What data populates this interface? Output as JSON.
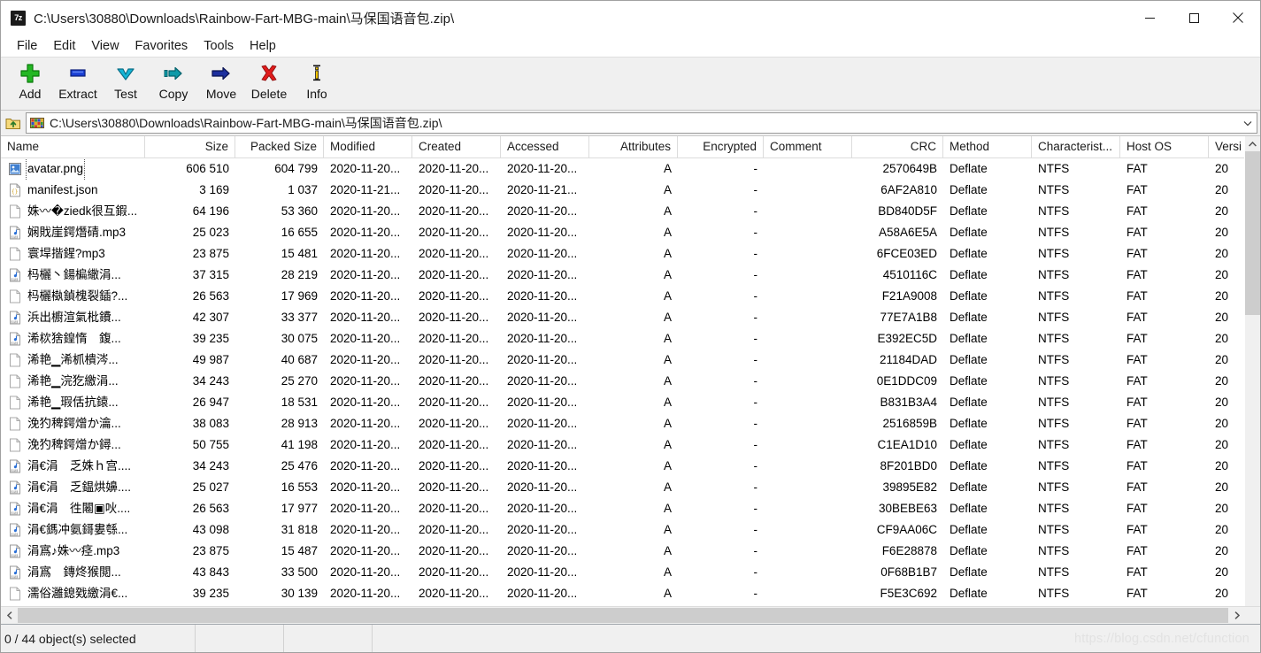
{
  "window": {
    "app_icon": "sevenzip-icon",
    "title": "C:\\Users\\30880\\Downloads\\Rainbow-Fart-MBG-main\\马保国语音包.zip\\",
    "minimize_label": "Minimize",
    "maximize_label": "Maximize",
    "close_label": "Close"
  },
  "menubar": {
    "items": [
      {
        "label": "File"
      },
      {
        "label": "Edit"
      },
      {
        "label": "View"
      },
      {
        "label": "Favorites"
      },
      {
        "label": "Tools"
      },
      {
        "label": "Help"
      }
    ]
  },
  "toolbar": {
    "buttons": [
      {
        "label": "Add",
        "icon": "plus-icon"
      },
      {
        "label": "Extract",
        "icon": "extract-icon"
      },
      {
        "label": "Test",
        "icon": "checkmark-down-icon"
      },
      {
        "label": "Copy",
        "icon": "copy-arrow-icon"
      },
      {
        "label": "Move",
        "icon": "move-arrow-icon"
      },
      {
        "label": "Delete",
        "icon": "red-x-icon"
      },
      {
        "label": "Info",
        "icon": "info-icon"
      }
    ]
  },
  "address": {
    "up_icon": "folder-up-icon",
    "archive_icon": "archive-icon",
    "path": "C:\\Users\\30880\\Downloads\\Rainbow-Fart-MBG-main\\马保国语音包.zip\\",
    "dropdown_icon": "chevron-down-icon"
  },
  "columns": [
    {
      "key": "name",
      "label": "Name",
      "width": 163,
      "align": "l"
    },
    {
      "key": "size",
      "label": "Size",
      "width": 102,
      "align": "r"
    },
    {
      "key": "packed",
      "label": "Packed Size",
      "width": 100,
      "align": "r"
    },
    {
      "key": "modified",
      "label": "Modified",
      "width": 100,
      "align": "l"
    },
    {
      "key": "created",
      "label": "Created",
      "width": 100,
      "align": "l"
    },
    {
      "key": "accessed",
      "label": "Accessed",
      "width": 100,
      "align": "l"
    },
    {
      "key": "attributes",
      "label": "Attributes",
      "width": 100,
      "align": "r"
    },
    {
      "key": "encrypted",
      "label": "Encrypted",
      "width": 97,
      "align": "r"
    },
    {
      "key": "comment",
      "label": "Comment",
      "width": 100,
      "align": "l"
    },
    {
      "key": "crc",
      "label": "CRC",
      "width": 103,
      "align": "r"
    },
    {
      "key": "method",
      "label": "Method",
      "width": 100,
      "align": "l"
    },
    {
      "key": "charact",
      "label": "Characterist...",
      "width": 100,
      "align": "l"
    },
    {
      "key": "hostos",
      "label": "Host OS",
      "width": 100,
      "align": "l"
    },
    {
      "key": "version",
      "label": "Versi",
      "width": 42,
      "align": "l"
    }
  ],
  "rows": [
    {
      "icon": "image-file-icon",
      "name": "avatar.png",
      "size": "606 510",
      "packed": "604 799",
      "modified": "2020-11-20...",
      "created": "2020-11-20...",
      "accessed": "2020-11-20...",
      "attributes": "A",
      "encrypted": "-",
      "comment": "",
      "crc": "2570649B",
      "method": "Deflate",
      "charact": "NTFS",
      "hostos": "FAT",
      "version": "20",
      "focus": true
    },
    {
      "icon": "json-file-icon",
      "name": "manifest.json",
      "size": "3 169",
      "packed": "1 037",
      "modified": "2020-11-21...",
      "created": "2020-11-20...",
      "accessed": "2020-11-21...",
      "attributes": "A",
      "encrypted": "-",
      "comment": "",
      "crc": "6AF2A810",
      "method": "Deflate",
      "charact": "NTFS",
      "hostos": "FAT",
      "version": "20"
    },
    {
      "icon": "generic-file-icon",
      "name": "姝〰�ziedk很互鍜...",
      "size": "64 196",
      "packed": "53 360",
      "modified": "2020-11-20...",
      "created": "2020-11-20...",
      "accessed": "2020-11-20...",
      "attributes": "A",
      "encrypted": "-",
      "comment": "",
      "crc": "BD840D5F",
      "method": "Deflate",
      "charact": "NTFS",
      "hostos": "FAT",
      "version": "20"
    },
    {
      "icon": "mp3-file-icon",
      "name": "娴戝崖鍔熸碃.mp3",
      "size": "25 023",
      "packed": "16 655",
      "modified": "2020-11-20...",
      "created": "2020-11-20...",
      "accessed": "2020-11-20...",
      "attributes": "A",
      "encrypted": "-",
      "comment": "",
      "crc": "A58A6E5A",
      "method": "Deflate",
      "charact": "NTFS",
      "hostos": "FAT",
      "version": "20"
    },
    {
      "icon": "generic-file-icon",
      "name": "寰垾揩鍟?mp3",
      "size": "23 875",
      "packed": "15 481",
      "modified": "2020-11-20...",
      "created": "2020-11-20...",
      "accessed": "2020-11-20...",
      "attributes": "A",
      "encrypted": "-",
      "comment": "",
      "crc": "6FCE03ED",
      "method": "Deflate",
      "charact": "NTFS",
      "hostos": "FAT",
      "version": "20"
    },
    {
      "icon": "mp3-file-icon",
      "name": "杩欐丶鍚楄繖涓...",
      "size": "37 315",
      "packed": "28 219",
      "modified": "2020-11-20...",
      "created": "2020-11-20...",
      "accessed": "2020-11-20...",
      "attributes": "A",
      "encrypted": "-",
      "comment": "",
      "crc": "4510116C",
      "method": "Deflate",
      "charact": "NTFS",
      "hostos": "FAT",
      "version": "20"
    },
    {
      "icon": "generic-file-icon",
      "name": "杩欐槸鍞槐裂鍤?...",
      "size": "26 563",
      "packed": "17 969",
      "modified": "2020-11-20...",
      "created": "2020-11-20...",
      "accessed": "2020-11-20...",
      "attributes": "A",
      "encrypted": "-",
      "comment": "",
      "crc": "F21A9008",
      "method": "Deflate",
      "charact": "NTFS",
      "hostos": "FAT",
      "version": "20"
    },
    {
      "icon": "mp3-file-icon",
      "name": "浜出櫥渲氣枇鐨...",
      "size": "42 307",
      "packed": "33 377",
      "modified": "2020-11-20...",
      "created": "2020-11-20...",
      "accessed": "2020-11-20...",
      "attributes": "A",
      "encrypted": "-",
      "comment": "",
      "crc": "77E7A1B8",
      "method": "Deflate",
      "charact": "NTFS",
      "hostos": "FAT",
      "version": "20"
    },
    {
      "icon": "mp3-file-icon",
      "name": "浠栨猞鍠惰　鍑...",
      "size": "39 235",
      "packed": "30 075",
      "modified": "2020-11-20...",
      "created": "2020-11-20...",
      "accessed": "2020-11-20...",
      "attributes": "A",
      "encrypted": "-",
      "comment": "",
      "crc": "E392EC5D",
      "method": "Deflate",
      "charact": "NTFS",
      "hostos": "FAT",
      "version": "20"
    },
    {
      "icon": "generic-file-icon",
      "name": "浠艳▁浠枛樻涔...",
      "size": "49 987",
      "packed": "40 687",
      "modified": "2020-11-20...",
      "created": "2020-11-20...",
      "accessed": "2020-11-20...",
      "attributes": "A",
      "encrypted": "-",
      "comment": "",
      "crc": "21184DAD",
      "method": "Deflate",
      "charact": "NTFS",
      "hostos": "FAT",
      "version": "20"
    },
    {
      "icon": "generic-file-icon",
      "name": "浠艳▁浣犵繳涓...",
      "size": "34 243",
      "packed": "25 270",
      "modified": "2020-11-20...",
      "created": "2020-11-20...",
      "accessed": "2020-11-20...",
      "attributes": "A",
      "encrypted": "-",
      "comment": "",
      "crc": "0E1DDC09",
      "method": "Deflate",
      "charact": "NTFS",
      "hostos": "FAT",
      "version": "20"
    },
    {
      "icon": "generic-file-icon",
      "name": "浠艳▁瑕佸抗鎱...",
      "size": "26 947",
      "packed": "18 531",
      "modified": "2020-11-20...",
      "created": "2020-11-20...",
      "accessed": "2020-11-20...",
      "attributes": "A",
      "encrypted": "-",
      "comment": "",
      "crc": "B831B3A4",
      "method": "Deflate",
      "charact": "NTFS",
      "hostos": "FAT",
      "version": "20"
    },
    {
      "icon": "generic-file-icon",
      "name": "浼犳稗鍔熷か瀹...",
      "size": "38 083",
      "packed": "28 913",
      "modified": "2020-11-20...",
      "created": "2020-11-20...",
      "accessed": "2020-11-20...",
      "attributes": "A",
      "encrypted": "-",
      "comment": "",
      "crc": "2516859B",
      "method": "Deflate",
      "charact": "NTFS",
      "hostos": "FAT",
      "version": "20"
    },
    {
      "icon": "generic-file-icon",
      "name": "浼犳稗鍔熷か鐞...",
      "size": "50 755",
      "packed": "41 198",
      "modified": "2020-11-20...",
      "created": "2020-11-20...",
      "accessed": "2020-11-20...",
      "attributes": "A",
      "encrypted": "-",
      "comment": "",
      "crc": "C1EA1D10",
      "method": "Deflate",
      "charact": "NTFS",
      "hostos": "FAT",
      "version": "20"
    },
    {
      "icon": "mp3-file-icon",
      "name": "涓€涓　乏姝ｈ宫....",
      "size": "34 243",
      "packed": "25 476",
      "modified": "2020-11-20...",
      "created": "2020-11-20...",
      "accessed": "2020-11-20...",
      "attributes": "A",
      "encrypted": "-",
      "comment": "",
      "crc": "8F201BD0",
      "method": "Deflate",
      "charact": "NTFS",
      "hostos": "FAT",
      "version": "20"
    },
    {
      "icon": "mp3-file-icon",
      "name": "涓€涓　乏鎾烘嬶....",
      "size": "25 027",
      "packed": "16 553",
      "modified": "2020-11-20...",
      "created": "2020-11-20...",
      "accessed": "2020-11-20...",
      "attributes": "A",
      "encrypted": "-",
      "comment": "",
      "crc": "39895E82",
      "method": "Deflate",
      "charact": "NTFS",
      "hostos": "FAT",
      "version": "20"
    },
    {
      "icon": "mp3-file-icon",
      "name": "涓€涓　徃闂▣吙....",
      "size": "26 563",
      "packed": "17 977",
      "modified": "2020-11-20...",
      "created": "2020-11-20...",
      "accessed": "2020-11-20...",
      "attributes": "A",
      "encrypted": "-",
      "comment": "",
      "crc": "30BEBE63",
      "method": "Deflate",
      "charact": "NTFS",
      "hostos": "FAT",
      "version": "20"
    },
    {
      "icon": "mp3-file-icon",
      "name": "涓€鎷冲氨鎶婁綔...",
      "size": "43 098",
      "packed": "31 818",
      "modified": "2020-11-20...",
      "created": "2020-11-20...",
      "accessed": "2020-11-20...",
      "attributes": "A",
      "encrypted": "-",
      "comment": "",
      "crc": "CF9AA06C",
      "method": "Deflate",
      "charact": "NTFS",
      "hostos": "FAT",
      "version": "20"
    },
    {
      "icon": "mp3-file-icon",
      "name": "涓寪♪姝〰痉.mp3",
      "size": "23 875",
      "packed": "15 487",
      "modified": "2020-11-20...",
      "created": "2020-11-20...",
      "accessed": "2020-11-20...",
      "attributes": "A",
      "encrypted": "-",
      "comment": "",
      "crc": "F6E28878",
      "method": "Deflate",
      "charact": "NTFS",
      "hostos": "FAT",
      "version": "20"
    },
    {
      "icon": "mp3-file-icon",
      "name": "涓寪　鏄炵猴閲...",
      "size": "43 843",
      "packed": "33 500",
      "modified": "2020-11-20...",
      "created": "2020-11-20...",
      "accessed": "2020-11-20...",
      "attributes": "A",
      "encrypted": "-",
      "comment": "",
      "crc": "0F68B1B7",
      "method": "Deflate",
      "charact": "NTFS",
      "hostos": "FAT",
      "version": "20"
    },
    {
      "icon": "generic-file-icon",
      "name": "濡俗灉鎴戣繳涓€...",
      "size": "39 235",
      "packed": "30 139",
      "modified": "2020-11-20...",
      "created": "2020-11-20...",
      "accessed": "2020-11-20...",
      "attributes": "A",
      "encrypted": "-",
      "comment": "",
      "crc": "F5E3C692",
      "method": "Deflate",
      "charact": "NTFS",
      "hostos": "FAT",
      "version": "20"
    }
  ],
  "statusbar": {
    "selection": "0 / 44 object(s) selected",
    "pane2": "",
    "pane3": "",
    "pane4": "",
    "watermark": "https://blog.csdn.net/cfunction"
  },
  "scroll": {
    "up_icon": "chevron-up-icon",
    "down_icon": "chevron-down-icon",
    "left_icon": "chevron-left-icon",
    "right_icon": "chevron-right-icon"
  }
}
